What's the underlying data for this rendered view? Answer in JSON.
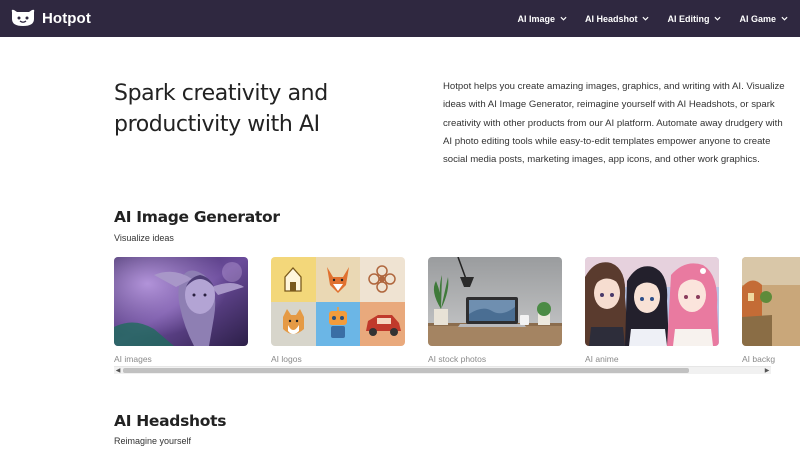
{
  "header": {
    "brand": "Hotpot",
    "logo_icon": "hotpot-logo-icon",
    "nav": [
      {
        "label": "AI Image"
      },
      {
        "label": "AI Headshot"
      },
      {
        "label": "AI Editing"
      },
      {
        "label": "AI Game"
      }
    ]
  },
  "hero": {
    "title": "Spark creativity and productivity with AI",
    "description": "Hotpot helps you create amazing images, graphics, and writing with AI. Visualize ideas with AI Image Generator, reimagine yourself with AI Headshots, or spark creativity with other products from our AI platform. Automate away drudgery with AI photo editing tools while easy-to-edit templates empower anyone to create social media posts, marketing images, app icons, and other work graphics."
  },
  "image_generator": {
    "title": "AI Image Generator",
    "subtitle": "Visualize ideas",
    "cards": [
      {
        "label": "AI images"
      },
      {
        "label": "AI logos"
      },
      {
        "label": "AI stock photos"
      },
      {
        "label": "AI anime"
      },
      {
        "label": "AI backg"
      }
    ]
  },
  "headshots": {
    "title": "AI Headshots",
    "subtitle": "Reimagine yourself"
  },
  "colors": {
    "header_bg": "#2f2840",
    "text": "#222222",
    "muted": "#8a8a8a"
  }
}
